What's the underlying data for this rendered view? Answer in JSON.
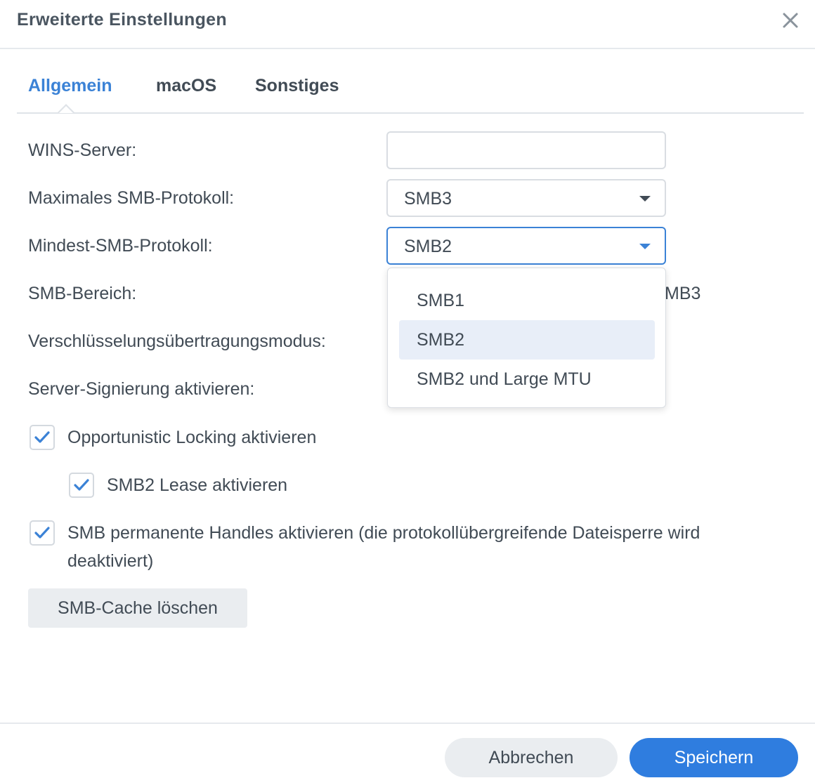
{
  "dialog": {
    "title": "Erweiterte Einstellungen",
    "close_icon": "close-icon"
  },
  "tabs": [
    {
      "label": "Allgemein",
      "active": true
    },
    {
      "label": "macOS",
      "active": false
    },
    {
      "label": "Sonstiges",
      "active": false
    }
  ],
  "form": {
    "wins_server": {
      "label": "WINS-Server:",
      "value": "",
      "placeholder": ""
    },
    "max_smb": {
      "label": "Maximales SMB-Protokoll:",
      "value": "SMB3"
    },
    "min_smb": {
      "label": "Mindest-SMB-Protokoll:",
      "value": "SMB2"
    },
    "smb_range": {
      "label": "SMB-Bereich:",
      "value_partial": "MB3"
    },
    "encryption_mode": {
      "label": "Verschlüsselungsübertragungsmodus:"
    },
    "server_signing": {
      "label": "Server-Signierung aktivieren:"
    }
  },
  "dropdown": {
    "options": [
      "SMB1",
      "SMB2",
      "SMB2 und Large MTU"
    ],
    "selected": "SMB2"
  },
  "checkboxes": {
    "oplocks": {
      "label": "Opportunistic Locking aktivieren",
      "checked": true
    },
    "smb2_lease": {
      "label": "SMB2 Lease aktivieren",
      "checked": true
    },
    "durable_handles": {
      "label": "SMB permanente Handles aktivieren (die protokollübergreifende Dateisperre wird deaktiviert)",
      "checked": true
    }
  },
  "buttons": {
    "clear_cache": "SMB-Cache löschen",
    "cancel": "Abbrechen",
    "save": "Speichern"
  },
  "colors": {
    "accent": "#3b82d6",
    "primary_button": "#2f7ddf",
    "text": "#414b55",
    "selected_option_bg": "#e8eef8"
  }
}
